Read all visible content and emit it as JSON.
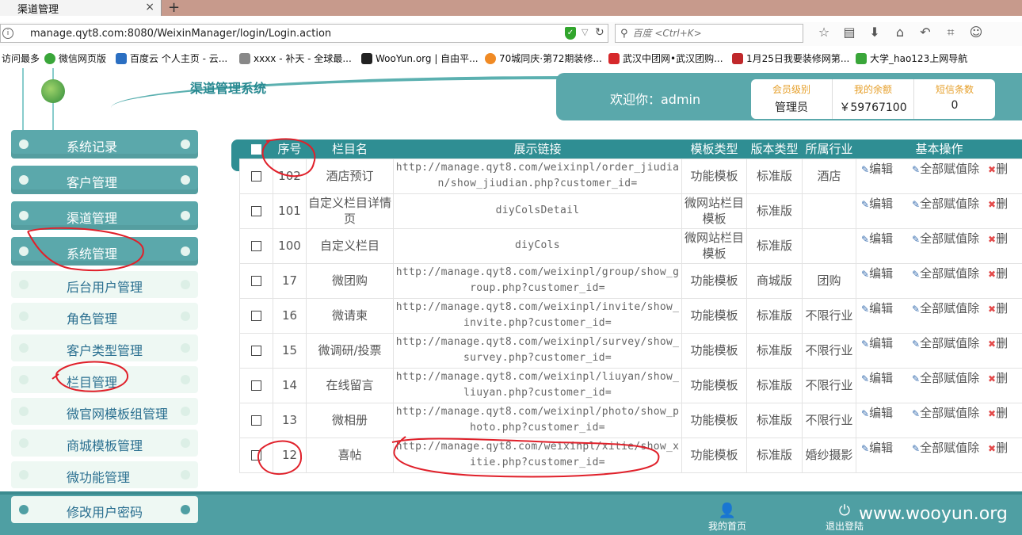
{
  "browser": {
    "tab_title": "渠道管理",
    "tab_close": "×",
    "new_tab": "+",
    "url": "manage.qyt8.com:8080/WeixinManager/login/Login.action",
    "search_placeholder": "百度 <Ctrl+K>",
    "bookmarks": [
      {
        "label": "访问最多",
        "icon_color": ""
      },
      {
        "label": "微信网页版",
        "icon_color": "#3aa63a"
      },
      {
        "label": "百度云 个人主页 - 云...",
        "icon_color": "#2b6fc2"
      },
      {
        "label": "xxxx - 补天 - 全球最...",
        "icon_color": "#888888"
      },
      {
        "label": "WooYun.org | 自由平...",
        "icon_color": "#222222"
      },
      {
        "label": "70城同庆·第72期装修...",
        "icon_color": "#f08a24"
      },
      {
        "label": "武汉中团网•武汉团购...",
        "icon_color": "#d6282b"
      },
      {
        "label": "1月25日我要装修网第...",
        "icon_color": "#c0282b"
      },
      {
        "label": "大学_hao123上网导航",
        "icon_color": "#3aa63a"
      }
    ]
  },
  "header": {
    "system_title": "渠道管理系统",
    "welcome": "欢迎你：admin",
    "info": [
      {
        "label": "会员级别",
        "value": "管理员"
      },
      {
        "label": "我的余额",
        "value": "￥59767100"
      },
      {
        "label": "短信条数",
        "value": "0"
      }
    ]
  },
  "sidebar": {
    "main": [
      "系统记录",
      "客户管理",
      "渠道管理",
      "系统管理"
    ],
    "sub": [
      "后台用户管理",
      "角色管理",
      "客户类型管理",
      "栏目管理",
      "微官网模板组管理",
      "商城模板管理",
      "微功能管理"
    ],
    "bottom": "修改用户密码"
  },
  "footer": {
    "home": "我的首页",
    "exit": "退出登陆",
    "watermark": "www.wooyun.org"
  },
  "table": {
    "headers": [
      "序号",
      "栏目名",
      "展示链接",
      "模板类型",
      "版本类型",
      "所属行业",
      "基本操作"
    ],
    "op_labels": {
      "edit": "编辑",
      "assign": "全部赋值除",
      "del": "删"
    },
    "rows": [
      {
        "id": "102",
        "name": "酒店预订",
        "link": "http://manage.qyt8.com/weixinpl/order_jiudian/show_jiudian.php?customer_id=",
        "tpl": "功能模板",
        "ver": "标准版",
        "ind": "酒店"
      },
      {
        "id": "101",
        "name": "自定义栏目详情页",
        "link": "diyColsDetail",
        "tpl": "微网站栏目模板",
        "ver": "标准版",
        "ind": ""
      },
      {
        "id": "100",
        "name": "自定义栏目",
        "link": "diyCols",
        "tpl": "微网站栏目模板",
        "ver": "标准版",
        "ind": ""
      },
      {
        "id": "17",
        "name": "微团购",
        "link": "http://manage.qyt8.com/weixinpl/group/show_group.php?customer_id=",
        "tpl": "功能模板",
        "ver": "商城版",
        "ind": "团购"
      },
      {
        "id": "16",
        "name": "微请柬",
        "link": "http://manage.qyt8.com/weixinpl/invite/show_invite.php?customer_id=",
        "tpl": "功能模板",
        "ver": "标准版",
        "ind": "不限行业"
      },
      {
        "id": "15",
        "name": "微调研/投票",
        "link": "http://manage.qyt8.com/weixinpl/survey/show_survey.php?customer_id=",
        "tpl": "功能模板",
        "ver": "标准版",
        "ind": "不限行业"
      },
      {
        "id": "14",
        "name": "在线留言",
        "link": "http://manage.qyt8.com/weixinpl/liuyan/show_liuyan.php?customer_id=",
        "tpl": "功能模板",
        "ver": "标准版",
        "ind": "不限行业"
      },
      {
        "id": "13",
        "name": "微相册",
        "link": "http://manage.qyt8.com/weixinpl/photo/show_photo.php?customer_id=",
        "tpl": "功能模板",
        "ver": "标准版",
        "ind": "不限行业"
      },
      {
        "id": "12",
        "name": "喜帖",
        "link": "http://manage.qyt8.com/weixinpl/xitie/show_xitie.php?customer_id=",
        "tpl": "功能模板",
        "ver": "标准版",
        "ind": "婚纱摄影"
      }
    ]
  }
}
